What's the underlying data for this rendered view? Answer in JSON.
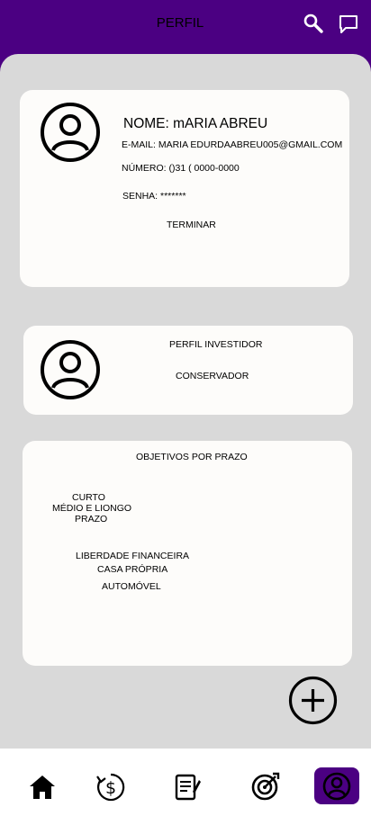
{
  "header": {
    "title": "PERFIL",
    "search_icon": "search-icon",
    "chat_icon": "chat-icon"
  },
  "profile": {
    "name_label": "NOME: mARIA ABREU",
    "email_label": "E-MAIL: MARIA EDURDAABREU005@GMAIL.COM",
    "phone_label": "NÚMERO: ()31 ( 0000-0000",
    "password_label": "SENHA: *******",
    "finish_button": "TERMINAR"
  },
  "investor": {
    "title": "PERFIL INVESTIDOR",
    "value": "CONSERVADOR"
  },
  "goals": {
    "title": "OBJETIVOS POR PRAZO",
    "terms": [
      "CURTO",
      "MÉDIO E LIONGO",
      "PRAZO"
    ],
    "items": [
      "LIBERDADE FINANCEIRA",
      "CASA PRÓPRIA",
      "AUTOMÓVEL"
    ]
  },
  "nav": {
    "items": [
      "home-icon",
      "dollar-refresh-icon",
      "notes-icon",
      "target-icon",
      "profile-icon"
    ],
    "active": "profile-icon"
  },
  "colors": {
    "brand": "#4b0082",
    "background": "#d9d9d9",
    "card": "#fdfcfa"
  }
}
